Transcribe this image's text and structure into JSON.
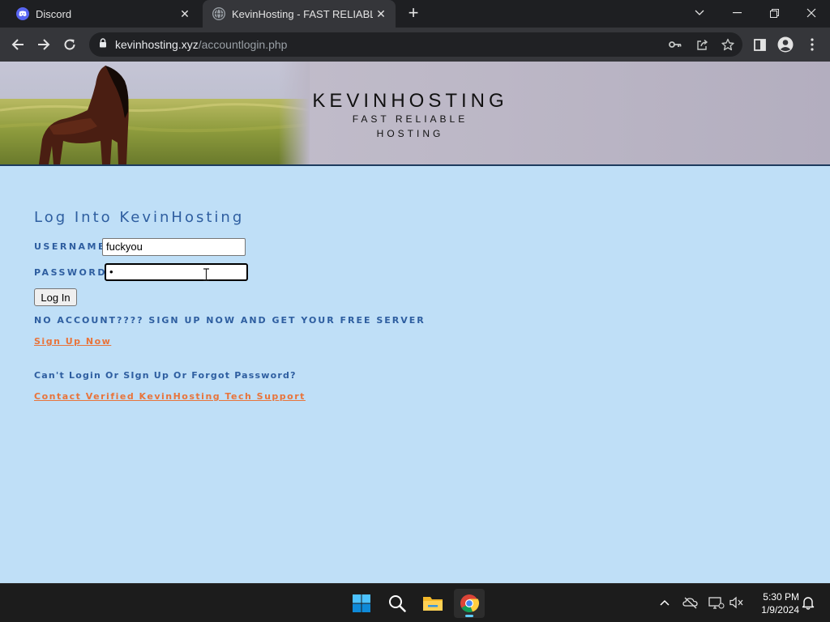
{
  "browser": {
    "tabs": [
      {
        "title": "Discord",
        "favicon": "discord-icon",
        "active": false
      },
      {
        "title": "KevinHosting - FAST RELIABLE HOSTING",
        "favicon": "globe-icon",
        "active": true
      }
    ],
    "address": {
      "domain": "kevinhosting.xyz",
      "path": "/accountlogin.php"
    }
  },
  "banner": {
    "brand_name": "KEVINHOSTING",
    "tagline": "FAST RELIABLE HOSTING"
  },
  "login": {
    "title": "Log Into KevinHosting",
    "username_label": "USERNAME",
    "username_value": "fuckyou",
    "password_label": "PASSWORD",
    "password_value": "•",
    "submit_label": "Log In",
    "no_account_text": "NO ACCOUNT???? SIGN UP NOW AND GET YOUR FREE SERVER",
    "signup_link": "Sign Up Now",
    "help_text": "Can't Login Or SIgn Up Or Forgot Password?",
    "support_link": "Contact Verified KevinHosting Tech Support"
  },
  "taskbar": {
    "time": "5:30 PM",
    "date": "1/9/2024"
  },
  "colors": {
    "page_bg": "#bfdff7",
    "heading_blue": "#2e5ea0",
    "link_orange": "#e8743b",
    "banner_border": "#1d3b5e"
  }
}
